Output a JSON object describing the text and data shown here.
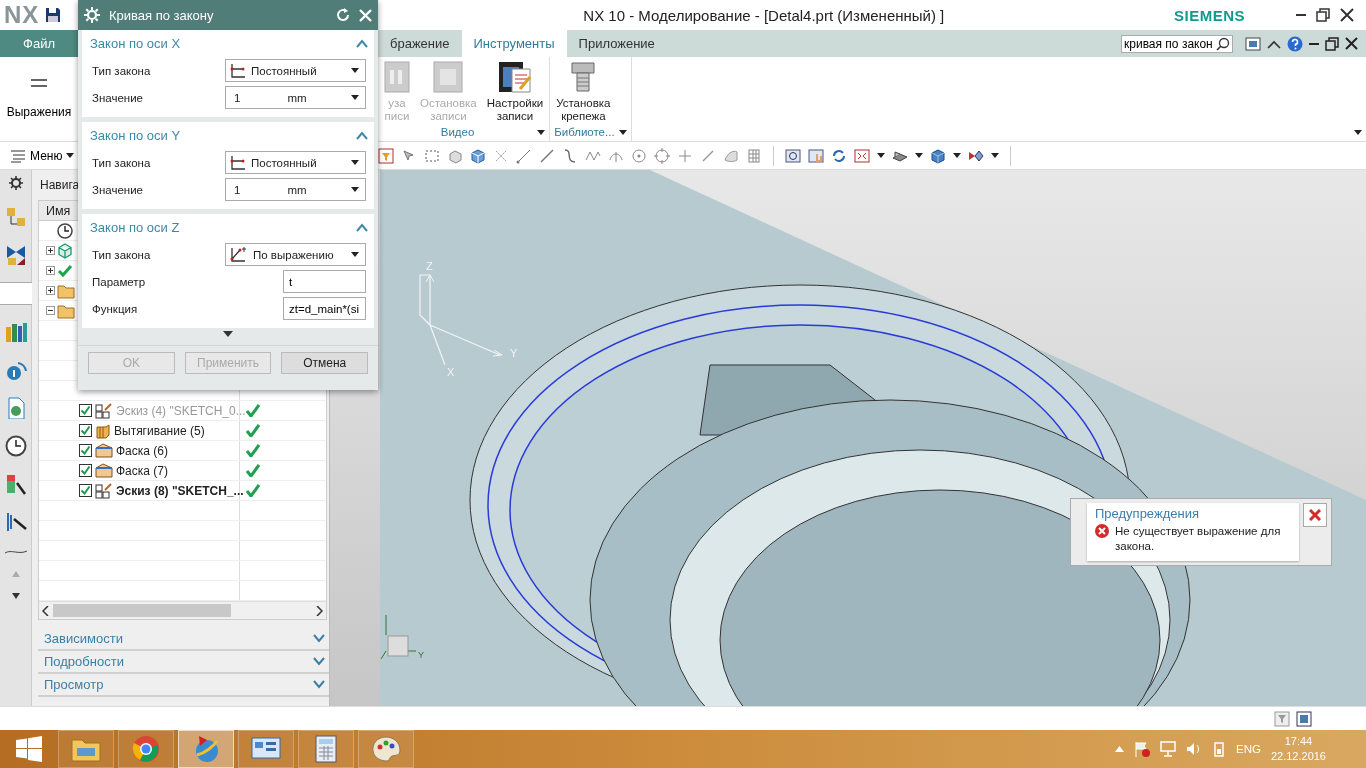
{
  "title_bar": {
    "logo": "NX",
    "title": "NX 10 - Моделирование - [Detal4.prt (Измененный) ]",
    "brand": "SIEMENS"
  },
  "tabs": [
    {
      "label": "Файл",
      "kind": "file",
      "selected": false
    },
    {
      "label": "бражение",
      "kind": "tab",
      "selected": false
    },
    {
      "label": "Инструменты",
      "kind": "tab",
      "selected": true
    },
    {
      "label": "Приложение",
      "kind": "tab",
      "selected": false
    }
  ],
  "search": {
    "value": "кривая по закон"
  },
  "ribbon": {
    "expressions": "Выражения",
    "groups": [
      {
        "label": "Видео",
        "buttons": [
          {
            "label": "уза\nписи",
            "kind": "pause",
            "disabled": true
          },
          {
            "label": "Остановка\nзаписи",
            "kind": "stop",
            "disabled": true
          },
          {
            "label": "Настройки\nзаписи",
            "kind": "settings",
            "disabled": false
          }
        ]
      },
      {
        "label": "Библиоте...",
        "buttons": [
          {
            "label": "Установка\nкрепежа",
            "kind": "fastener",
            "disabled": false
          }
        ]
      }
    ]
  },
  "toolbar": {
    "menu": "Меню"
  },
  "navigator": {
    "title": "Навига",
    "column": "Имя",
    "rows": [
      {
        "kind": "clock",
        "expandable": false
      },
      {
        "kind": "body",
        "expandable": true,
        "expanded": false
      },
      {
        "kind": "check",
        "expandable": true,
        "expanded": false
      },
      {
        "kind": "folder",
        "expandable": true,
        "expanded": false
      },
      {
        "kind": "folder",
        "expandable": true,
        "expanded": true,
        "children": [
          {
            "kind": "sketch",
            "label": "Эскиз (4) \"SKETCH_0...",
            "checked": true,
            "disabled": true,
            "current": false
          },
          {
            "kind": "extrude",
            "label": "Вытягивание (5)",
            "checked": true,
            "disabled": false,
            "current": false
          },
          {
            "kind": "chamfer",
            "label": "Фаска (6)",
            "checked": true,
            "disabled": false,
            "current": false
          },
          {
            "kind": "chamfer",
            "label": "Фаска (7)",
            "checked": true,
            "disabled": false,
            "current": false
          },
          {
            "kind": "sketch",
            "label": "Эскиз (8) \"SKETCH_...",
            "checked": true,
            "disabled": false,
            "current": true
          }
        ]
      }
    ],
    "sections": [
      {
        "label": "Зависимости",
        "expanded": false
      },
      {
        "label": "Подробности",
        "expanded": false
      },
      {
        "label": "Просмотр",
        "expanded": false
      }
    ]
  },
  "viewport": {
    "axis_labels": [
      "Z",
      "Y",
      "X"
    ],
    "corner_axis_label": "Y"
  },
  "warning": {
    "title": "Предупреждения",
    "message": "Не существует выражение для закона."
  },
  "dialog": {
    "title": "Кривая по закону",
    "sections": [
      {
        "title": "Закон по оси X",
        "expanded": true,
        "rows": [
          {
            "kind": "select",
            "label": "Тип закона",
            "value": "Постоянный"
          },
          {
            "kind": "unit",
            "label": "Значение",
            "value": "1",
            "unit": "mm"
          }
        ]
      },
      {
        "title": "Закон по оси Y",
        "expanded": true,
        "rows": [
          {
            "kind": "select",
            "label": "Тип закона",
            "value": "Постоянный"
          },
          {
            "kind": "unit",
            "label": "Значение",
            "value": "1",
            "unit": "mm"
          }
        ]
      },
      {
        "title": "Закон по оси Z",
        "expanded": true,
        "rows": [
          {
            "kind": "select",
            "label": "Тип закона",
            "value": "По выражению"
          },
          {
            "kind": "text",
            "label": "Параметр",
            "value": "t"
          },
          {
            "kind": "text",
            "label": "Функция",
            "value": "zt=d_main*(si"
          }
        ]
      }
    ],
    "buttons": [
      {
        "label": "OK",
        "disabled": true
      },
      {
        "label": "Применить",
        "disabled": true
      },
      {
        "label": "Отмена",
        "disabled": false
      }
    ]
  },
  "taskbar": {
    "apps": [
      {
        "kind": "folder",
        "selected": false
      },
      {
        "kind": "browser",
        "selected": false
      },
      {
        "kind": "globe",
        "selected": true
      },
      {
        "kind": "panel",
        "selected": false
      },
      {
        "kind": "calculator",
        "selected": false
      },
      {
        "kind": "paint",
        "selected": false
      }
    ],
    "lang": "ENG",
    "time": "17:44",
    "date": "22.12.2016"
  }
}
